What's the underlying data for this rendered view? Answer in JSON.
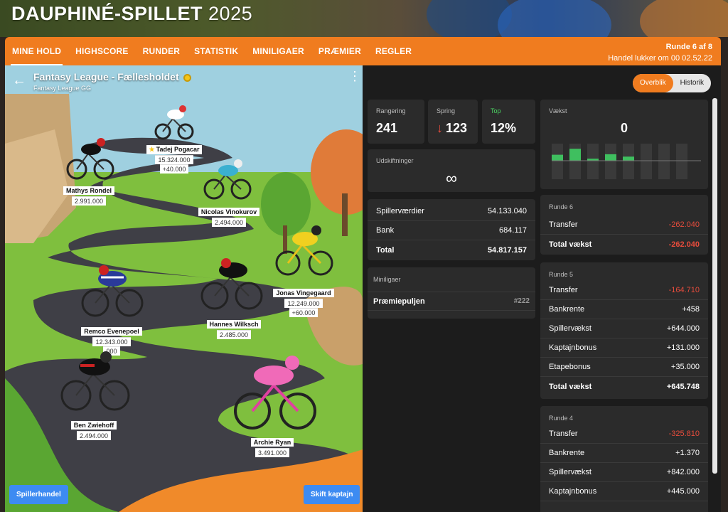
{
  "brand": {
    "name": "DAUPHINÉ-SPILLET",
    "year": "2025"
  },
  "nav": {
    "items": [
      "MINE HOLD",
      "HIGHSCORE",
      "RUNDER",
      "STATISTIK",
      "MINILIGAER",
      "PRÆMIER",
      "REGLER"
    ],
    "active": "MINE HOLD",
    "round": "Runde 6 af 8",
    "trade_closes": "Handel lukker om 00 02.52.22"
  },
  "team": {
    "name": "Fantasy League - Fællesholdet",
    "league": "Fantasy League GG",
    "riders": [
      {
        "name": "Tadej Pogacar",
        "value": "15.324.000",
        "delta": "+40.000",
        "captain": true
      },
      {
        "name": "Mathys Rondel",
        "value": "2.991.000"
      },
      {
        "name": "Nicolas Vinokurov",
        "value": "2.494.000"
      },
      {
        "name": "Jonas Vingegaard",
        "value": "12.249.000",
        "delta": "+60.000"
      },
      {
        "name": "Remco Evenepoel",
        "value": "12.343.000",
        "delta": "000"
      },
      {
        "name": "Hannes Wilksch",
        "value": "2.485.000"
      },
      {
        "name": "Ben Zwiehoff",
        "value": "2.494.000"
      },
      {
        "name": "Archie Ryan",
        "value": "3.491.000"
      }
    ],
    "trade_button": "Spillerhandel",
    "captain_button": "Skift kaptajn"
  },
  "right": {
    "toggle": {
      "overview": "Overblik",
      "history": "Historik"
    },
    "stats": {
      "rank_label": "Rangering",
      "rank": "241",
      "jump_label": "Spring",
      "jump": "123",
      "top_label": "Top",
      "top": "12%",
      "growth_label": "Vækst",
      "growth": "0",
      "subs_label": "Udskiftninger",
      "subs": "∞"
    },
    "growth_bars": [
      0.35,
      0.7,
      0.12,
      0.38,
      0.24,
      0,
      0,
      0
    ],
    "values": {
      "rows": [
        {
          "label": "Spillerværdier",
          "value": "54.133.040"
        },
        {
          "label": "Bank",
          "value": "684.117"
        },
        {
          "label": "Total",
          "value": "54.817.157"
        }
      ]
    },
    "minileagues": {
      "title": "Miniligaer",
      "name": "Præmiepuljen",
      "rank": "#222"
    },
    "rounds": [
      {
        "title": "Runde 6",
        "rows": [
          {
            "label": "Transfer",
            "value": "-262.040",
            "neg": true
          },
          {
            "label": "Total vækst",
            "value": "-262.040",
            "neg": true
          }
        ]
      },
      {
        "title": "Runde 5",
        "rows": [
          {
            "label": "Transfer",
            "value": "-164.710",
            "neg": true
          },
          {
            "label": "Bankrente",
            "value": "+458"
          },
          {
            "label": "Spillervækst",
            "value": "+644.000"
          },
          {
            "label": "Kaptajnbonus",
            "value": "+131.000"
          },
          {
            "label": "Etapebonus",
            "value": "+35.000"
          },
          {
            "label": "Total vækst",
            "value": "+645.748"
          }
        ]
      },
      {
        "title": "Runde 4",
        "rows": [
          {
            "label": "Transfer",
            "value": "-325.810",
            "neg": true
          },
          {
            "label": "Bankrente",
            "value": "+1.370"
          },
          {
            "label": "Spillervækst",
            "value": "+842.000"
          },
          {
            "label": "Kaptajnbonus",
            "value": "+445.000"
          }
        ]
      }
    ]
  }
}
